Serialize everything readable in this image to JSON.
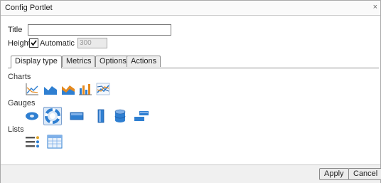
{
  "dialog": {
    "title": "Config Portlet",
    "close_glyph": "×"
  },
  "form": {
    "title_label": "Title",
    "title_value": "",
    "height_label": "Height",
    "automatic_label": "Automatic",
    "automatic_checked": true,
    "height_value": "300"
  },
  "tabs": [
    {
      "label": "Display type",
      "active": true
    },
    {
      "label": "Metrics",
      "active": false
    },
    {
      "label": "Options",
      "active": false
    },
    {
      "label": "Actions",
      "active": false
    }
  ],
  "sections": {
    "charts": {
      "label": "Charts",
      "icons": [
        "line-chart-icon",
        "area-chart-icon",
        "stacked-area-chart-icon",
        "bar-chart-icon",
        "multi-line-chart-icon"
      ]
    },
    "gauges": {
      "label": "Gauges",
      "icons": [
        "oval-gauge-icon",
        "dial-gauge-icon",
        "horizontal-bar-gauge-icon",
        "vertical-bar-gauge-icon",
        "cylinder-gauge-icon",
        "step-gauge-icon"
      ],
      "selected": "dial-gauge-icon"
    },
    "lists": {
      "label": "Lists",
      "icons": [
        "bullet-list-icon",
        "grid-list-icon"
      ]
    }
  },
  "footer": {
    "apply_label": "Apply",
    "cancel_label": "Cancel"
  },
  "colors": {
    "accent": "#2f7fd1",
    "accent_dark": "#1b5aa6",
    "bar_orange": "#e58a1f",
    "gold": "#e0a62a"
  }
}
